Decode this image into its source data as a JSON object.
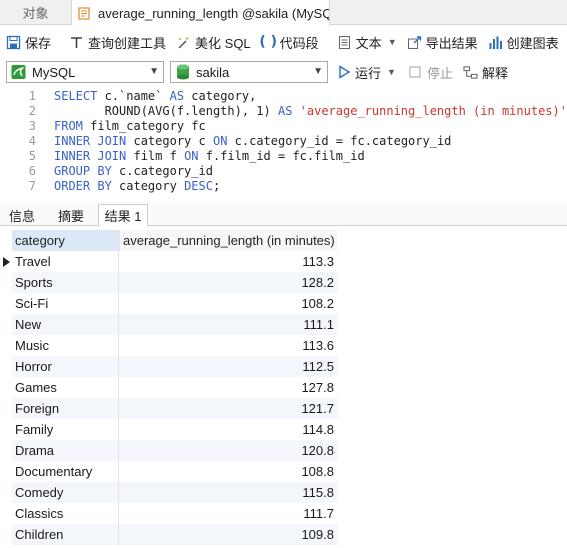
{
  "tabs": {
    "objects_label": "对象",
    "query_label": "average_running_length @sakila (MySQ..."
  },
  "toolbar": {
    "save": "保存",
    "query_builder": "查询创建工具",
    "beautify_sql": "美化 SQL",
    "code_snippet": "代码段",
    "text": "文本",
    "export_result": "导出结果",
    "create_chart": "创建图表"
  },
  "toolbar2": {
    "connection": "MySQL",
    "database": "sakila",
    "run": "运行",
    "stop": "停止",
    "explain": "解释"
  },
  "editor": {
    "lines": [
      {
        "n": "1",
        "parts": [
          [
            "kw",
            "SELECT "
          ],
          [
            "id",
            "c.`name` "
          ],
          [
            "kw",
            "AS "
          ],
          [
            "id",
            "category,"
          ]
        ]
      },
      {
        "n": "2",
        "parts": [
          [
            "id",
            "       ROUND(AVG(f.length), 1) "
          ],
          [
            "kw",
            "AS "
          ],
          [
            "str",
            "'average_running_length (in minutes)'"
          ]
        ]
      },
      {
        "n": "3",
        "parts": [
          [
            "kw",
            "FROM "
          ],
          [
            "id",
            "film_category fc"
          ]
        ]
      },
      {
        "n": "4",
        "parts": [
          [
            "kw",
            "INNER JOIN "
          ],
          [
            "id",
            "category c "
          ],
          [
            "kw",
            "ON "
          ],
          [
            "id",
            "c.category_id = fc.category_id"
          ]
        ]
      },
      {
        "n": "5",
        "parts": [
          [
            "kw",
            "INNER JOIN "
          ],
          [
            "id",
            "film f "
          ],
          [
            "kw",
            "ON "
          ],
          [
            "id",
            "f.film_id = fc.film_id"
          ]
        ]
      },
      {
        "n": "6",
        "parts": [
          [
            "kw",
            "GROUP BY "
          ],
          [
            "id",
            "c.category_id"
          ]
        ]
      },
      {
        "n": "7",
        "parts": [
          [
            "kw",
            "ORDER BY "
          ],
          [
            "id",
            "category "
          ],
          [
            "kw",
            "DESC"
          ],
          [
            "id",
            ";"
          ]
        ]
      }
    ]
  },
  "result_tabs": [
    "信息",
    "摘要",
    "结果 1"
  ],
  "grid": {
    "columns": [
      "category",
      "average_running_length (in minutes)"
    ],
    "rows": [
      [
        "Travel",
        "113.3"
      ],
      [
        "Sports",
        "128.2"
      ],
      [
        "Sci-Fi",
        "108.2"
      ],
      [
        "New",
        "111.1"
      ],
      [
        "Music",
        "113.6"
      ],
      [
        "Horror",
        "112.5"
      ],
      [
        "Games",
        "127.8"
      ],
      [
        "Foreign",
        "121.7"
      ],
      [
        "Family",
        "114.8"
      ],
      [
        "Drama",
        "120.8"
      ],
      [
        "Documentary",
        "108.8"
      ],
      [
        "Comedy",
        "115.8"
      ],
      [
        "Classics",
        "111.7"
      ],
      [
        "Children",
        "109.8"
      ]
    ]
  }
}
